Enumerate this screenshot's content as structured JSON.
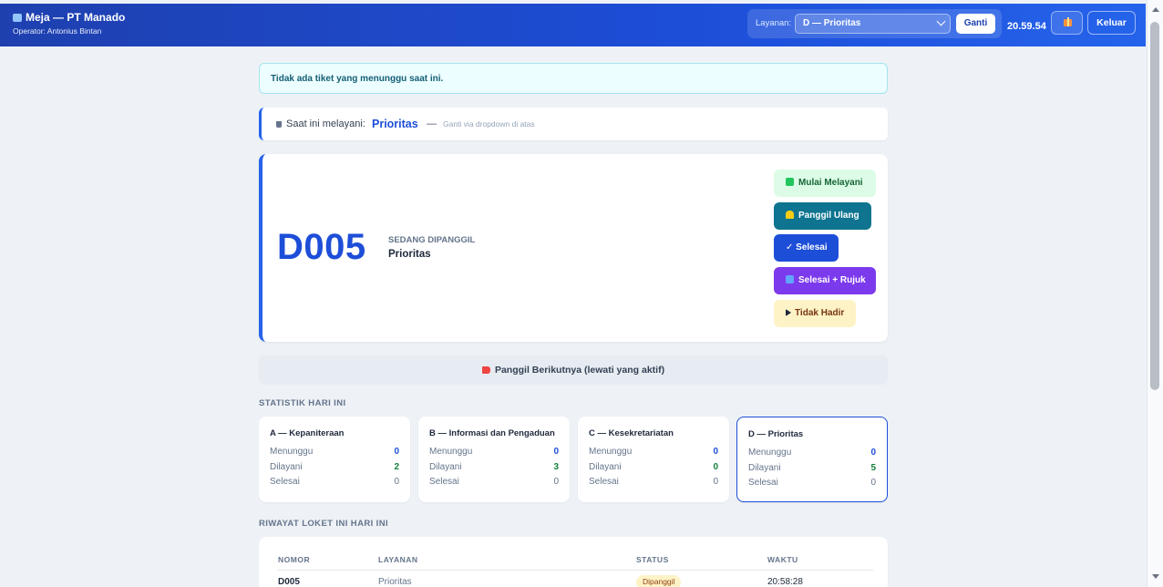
{
  "header": {
    "title": "Meja — PT Manado",
    "operator": "Operator: Antonius Bintan",
    "layanan_label": "Layanan:",
    "layanan_selected": "D — Prioritas",
    "ganti_label": "Ganti",
    "clock": "20.59.54",
    "keluar_label": "Keluar"
  },
  "notice": "Tidak ada tiket yang menunggu saat ini.",
  "serving": {
    "label": "Saat ini melayani:",
    "value": "Prioritas",
    "dash": "—",
    "hint": "Ganti via dropdown di atas"
  },
  "ticket": {
    "number": "D005",
    "status_label": "SEDANG DIPANGGIL",
    "service": "Prioritas"
  },
  "actions": {
    "mulai": "Mulai Melayani",
    "panggil_ulang": "Panggil Ulang",
    "selesai": "✓ Selesai",
    "selesai_rujuk": "Selesai + Rujuk",
    "tidak_hadir": "Tidak Hadir"
  },
  "next_button": "Panggil Berikutnya (lewati yang aktif)",
  "stats": {
    "title": "STATISTIK HARI INI",
    "row_labels": {
      "waiting": "Menunggu",
      "served": "Dilayani",
      "done": "Selesai"
    },
    "cards": [
      {
        "name": "A — Kepaniteraan",
        "waiting": "0",
        "served": "2",
        "done": "0"
      },
      {
        "name": "B — Informasi dan Pengaduan",
        "waiting": "0",
        "served": "3",
        "done": "0"
      },
      {
        "name": "C — Kesekretariatan",
        "waiting": "0",
        "served": "0",
        "done": "0"
      },
      {
        "name": "D — Prioritas",
        "waiting": "0",
        "served": "5",
        "done": "0"
      }
    ]
  },
  "history": {
    "title": "RIWAYAT LOKET INI HARI INI",
    "columns": [
      "NOMOR",
      "LAYANAN",
      "STATUS",
      "WAKTU"
    ],
    "rows": [
      {
        "nomor": "D005",
        "layanan": "Prioritas",
        "status": "Dipanggil",
        "waktu": "20:58:28"
      }
    ]
  }
}
